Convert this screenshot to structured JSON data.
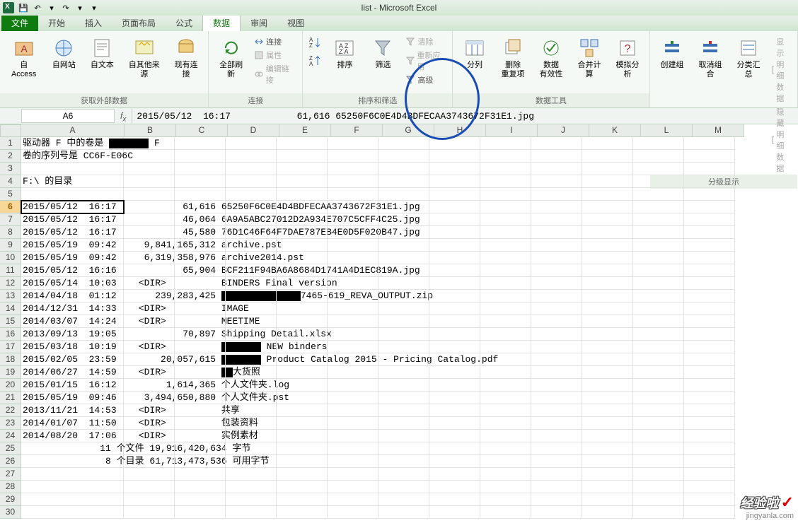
{
  "app": {
    "title": "list - Microsoft Excel"
  },
  "qat": {
    "save": "💾",
    "undo": "↶",
    "redo": "↷",
    "dd": "▾"
  },
  "tabs": {
    "file": "文件",
    "home": "开始",
    "insert": "插入",
    "layout": "页面布局",
    "formula": "公式",
    "data": "数据",
    "review": "审阅",
    "view": "视图"
  },
  "ribbon": {
    "g1": {
      "label": "获取外部数据",
      "access": "自 Access",
      "web": "自网站",
      "text": "自文本",
      "other": "自其他来源",
      "conn": "现有连接"
    },
    "g2": {
      "label": "连接",
      "refresh": "全部刷新",
      "lnk": "连接",
      "prop": "属性",
      "edit": "编辑链接"
    },
    "g3": {
      "label": "排序和筛选",
      "az": "A↓Z",
      "za": "Z↓A",
      "sort": "排序",
      "filter": "筛选",
      "clear": "清除",
      "reapply": "重新应用",
      "adv": "高级"
    },
    "g4": {
      "label": "数据工具",
      "split": "分列",
      "dup": "删除\n重复项",
      "valid": "数据\n有效性",
      "consol": "合并计算",
      "whatif": "模拟分析"
    },
    "g5": {
      "label": "分级显示",
      "group": "创建组",
      "ungroup": "取消组合",
      "subtotal": "分类汇总",
      "show": "显示明细数据",
      "hide": "隐藏明细数据"
    }
  },
  "namebox": "A6",
  "formula": "2015/05/12  16:17            61,616 65250F6C0E4D4BDFECAA3743672F31E1.jpg",
  "cols": [
    "A",
    "B",
    "C",
    "D",
    "E",
    "F",
    "G",
    "H",
    "I",
    "J",
    "K",
    "L",
    "M"
  ],
  "rows_hdr": [
    1,
    2,
    3,
    4,
    5,
    6,
    7,
    8,
    9,
    10,
    11,
    12,
    13,
    14,
    15,
    16,
    17,
    18,
    19,
    20,
    21,
    22,
    23,
    24,
    25,
    26,
    27,
    28,
    29,
    30
  ],
  "sel_row": 6,
  "data_rows": {
    "1": "驱动器 F 中的卷是 ███████ F",
    "2": "卷的序列号是 CC6F-E06C",
    "4": "F:\\ 的目录",
    "6": "2015/05/12  16:17            61,616 65250F6C0E4D4BDFECAA3743672F31E1.jpg",
    "7": "2015/05/12  16:17            46,064 6A9A5ABC27012D2A934E707C5CFF4C25.jpg",
    "8": "2015/05/12  16:17            45,580 76D1C46F64F7DAE787EB4E0D5F020B47.jpg",
    "9": "2015/05/19  09:42     9,841,165,312 archive.pst",
    "10": "2015/05/19  09:42     6,319,358,976 archive2014.pst",
    "11": "2015/05/12  16:16            65,904 BCF211F94BA6A8684D1741A4D1EC819A.jpg",
    "12": "2015/05/14  10:03    <DIR>          BINDERS Final version",
    "13": "2014/04/18  01:12       239,283,425 ██████████████7465-619_REVA_OUTPUT.zip",
    "14": "2014/12/31  14:33    <DIR>          IMAGE",
    "15": "2014/03/07  14:24    <DIR>          MEETIME",
    "16": "2013/09/13  19:05            70,897 Shipping Detail.xlsx",
    "17": "2015/03/18  10:19    <DIR>          ███████ NEW binders",
    "18": "2015/02/05  23:59        20,057,615 ███████ Product Catalog 2015 - Pricing Catalog.pdf",
    "19": "2014/06/27  14:59    <DIR>          ██大货照",
    "20": "2015/01/15  16:12         1,614,365 个人文件夹.log",
    "21": "2015/05/19  09:46     3,494,650,880 个人文件夹.pst",
    "22": "2013/11/21  14:53    <DIR>          共享",
    "23": "2014/01/07  11:50    <DIR>          包装资料",
    "24": "2014/08/20  17:06    <DIR>          实例素材",
    "25": "              11 个文件 19,916,420,634 字节",
    "26": "               8 个目录 61,713,473,536 可用字节"
  },
  "watermark": {
    "line1": "经验啦",
    "line2": "jingyanla.com"
  }
}
